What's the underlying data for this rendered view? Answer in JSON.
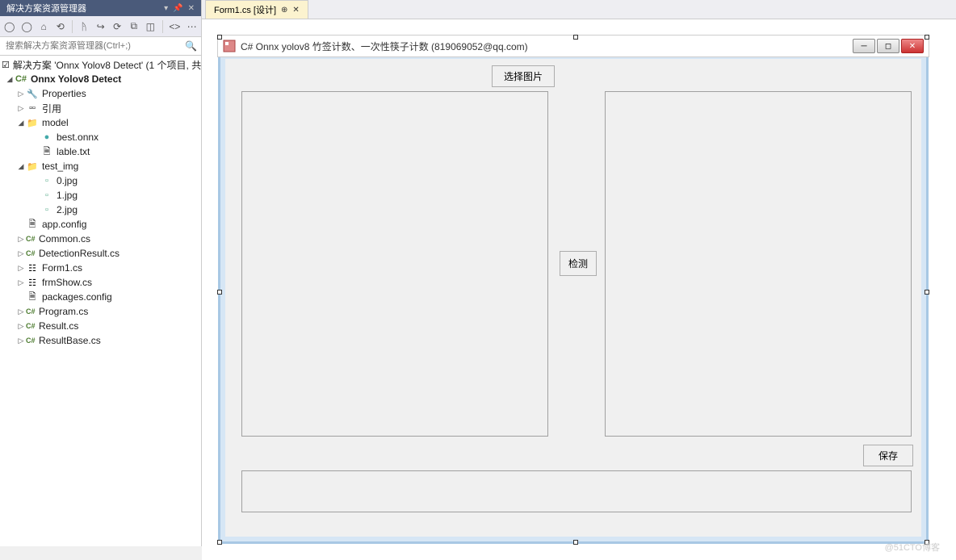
{
  "solutionExplorer": {
    "title": "解决方案资源管理器",
    "searchPlaceholder": "搜索解决方案资源管理器(Ctrl+;)",
    "tree": {
      "solution": "解决方案 'Onnx Yolov8 Detect' (1 个项目, 共",
      "project": "Onnx Yolov8 Detect",
      "properties": "Properties",
      "references": "引用",
      "model": "model",
      "bestOnnx": "best.onnx",
      "lableTxt": "lable.txt",
      "testImg": "test_img",
      "img0": "0.jpg",
      "img1": "1.jpg",
      "img2": "2.jpg",
      "appConfig": "app.config",
      "commonCs": "Common.cs",
      "detectionResultCs": "DetectionResult.cs",
      "form1Cs": "Form1.cs",
      "frmShowCs": "frmShow.cs",
      "packagesConfig": "packages.config",
      "programCs": "Program.cs",
      "resultCs": "Result.cs",
      "resultBaseCs": "ResultBase.cs"
    }
  },
  "tab": {
    "label": "Form1.cs [设计]"
  },
  "form": {
    "title": "C# Onnx yolov8 竹签计数、一次性筷子计数    (819069052@qq.com)",
    "selectImageBtn": "选择图片",
    "detectBtn": "检测",
    "saveBtn": "保存"
  },
  "watermark": "@51CTO博客"
}
